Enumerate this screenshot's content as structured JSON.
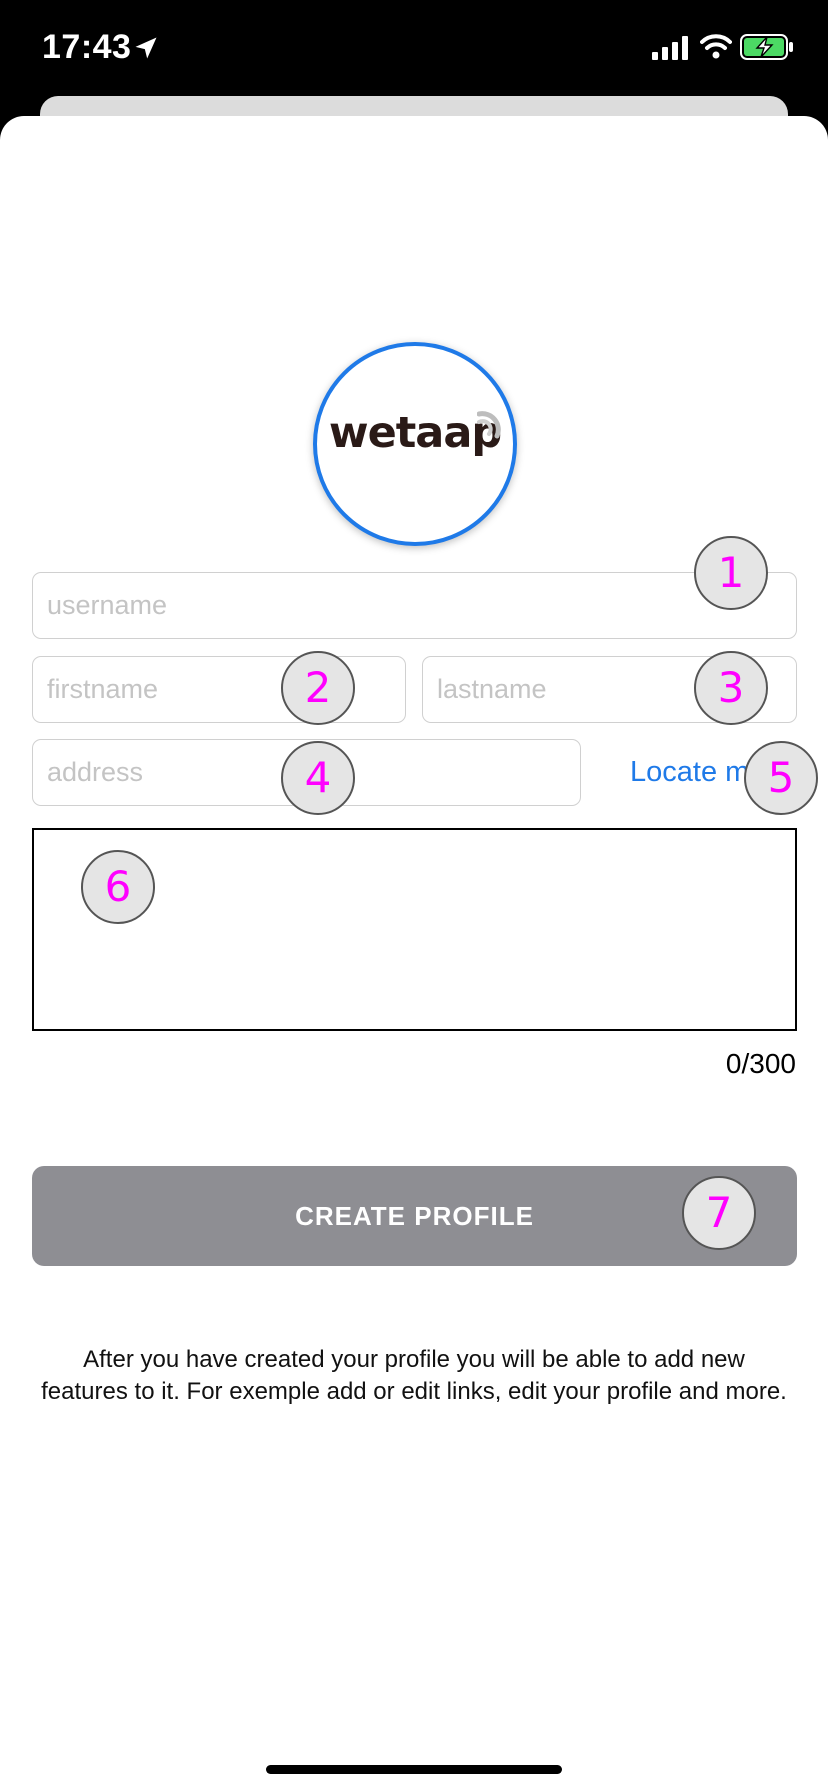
{
  "status_bar": {
    "time": "17:43",
    "icons": [
      "location-arrow-icon",
      "cellular-signal-icon",
      "wifi-icon",
      "battery-charging-icon"
    ]
  },
  "logo": {
    "text": "wetaap",
    "ring_color": "#1f7ae8"
  },
  "form": {
    "username_placeholder": "username",
    "username_value": "",
    "firstname_placeholder": "firstname",
    "firstname_value": "",
    "lastname_placeholder": "lastname",
    "lastname_value": "",
    "address_placeholder": "address",
    "address_value": "",
    "locate_label": "Locate m",
    "bio_value": "",
    "counter": "0/300",
    "create_label": "CREATE PROFILE"
  },
  "info_text": "After you have created your profile you will be able to add new features to it. For exemple add or edit links, edit your profile and more.",
  "markers": [
    "1",
    "2",
    "3",
    "4",
    "5",
    "6",
    "7"
  ],
  "colors": {
    "accent": "#1f7ae8",
    "button": "#8e8e93",
    "marker_text": "#ff00ff"
  }
}
